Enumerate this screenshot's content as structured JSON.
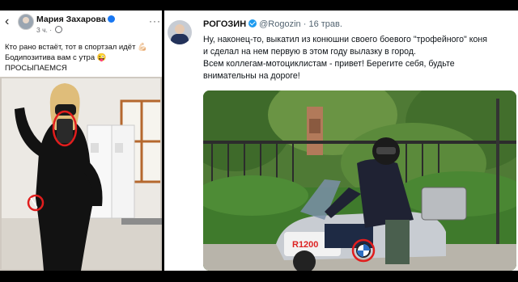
{
  "left_post": {
    "back_icon": "chevron-left-icon",
    "author": "Мария Захарова",
    "time": "3 ч.",
    "more_icon": "more-icon",
    "text_lines": [
      "Кто рано встаёт, тот в спортзал идёт 💪🏻",
      "Бодипозитива вам с утра 😜",
      "ПРОСЫПАЕМСЯ"
    ],
    "highlight_color": "#e11d1d"
  },
  "right_post": {
    "name": "РОГОЗИН",
    "handle": "@Rogozin",
    "separator": "·",
    "date": "16 трав.",
    "text_lines": [
      "Ну, наконец-то, выкатил из конюшни своего боевого \"трофейного\" коня",
      "и сделал на нем первую в этом году вылазку в город.",
      "Всем коллегам-мотоциклистам - привет! Берегите себя, будьте",
      "внимательны на дороге!"
    ],
    "photo_plate_text": "R1200",
    "verified_color": "#1d9bf0",
    "highlight_color": "#e11d1d"
  }
}
